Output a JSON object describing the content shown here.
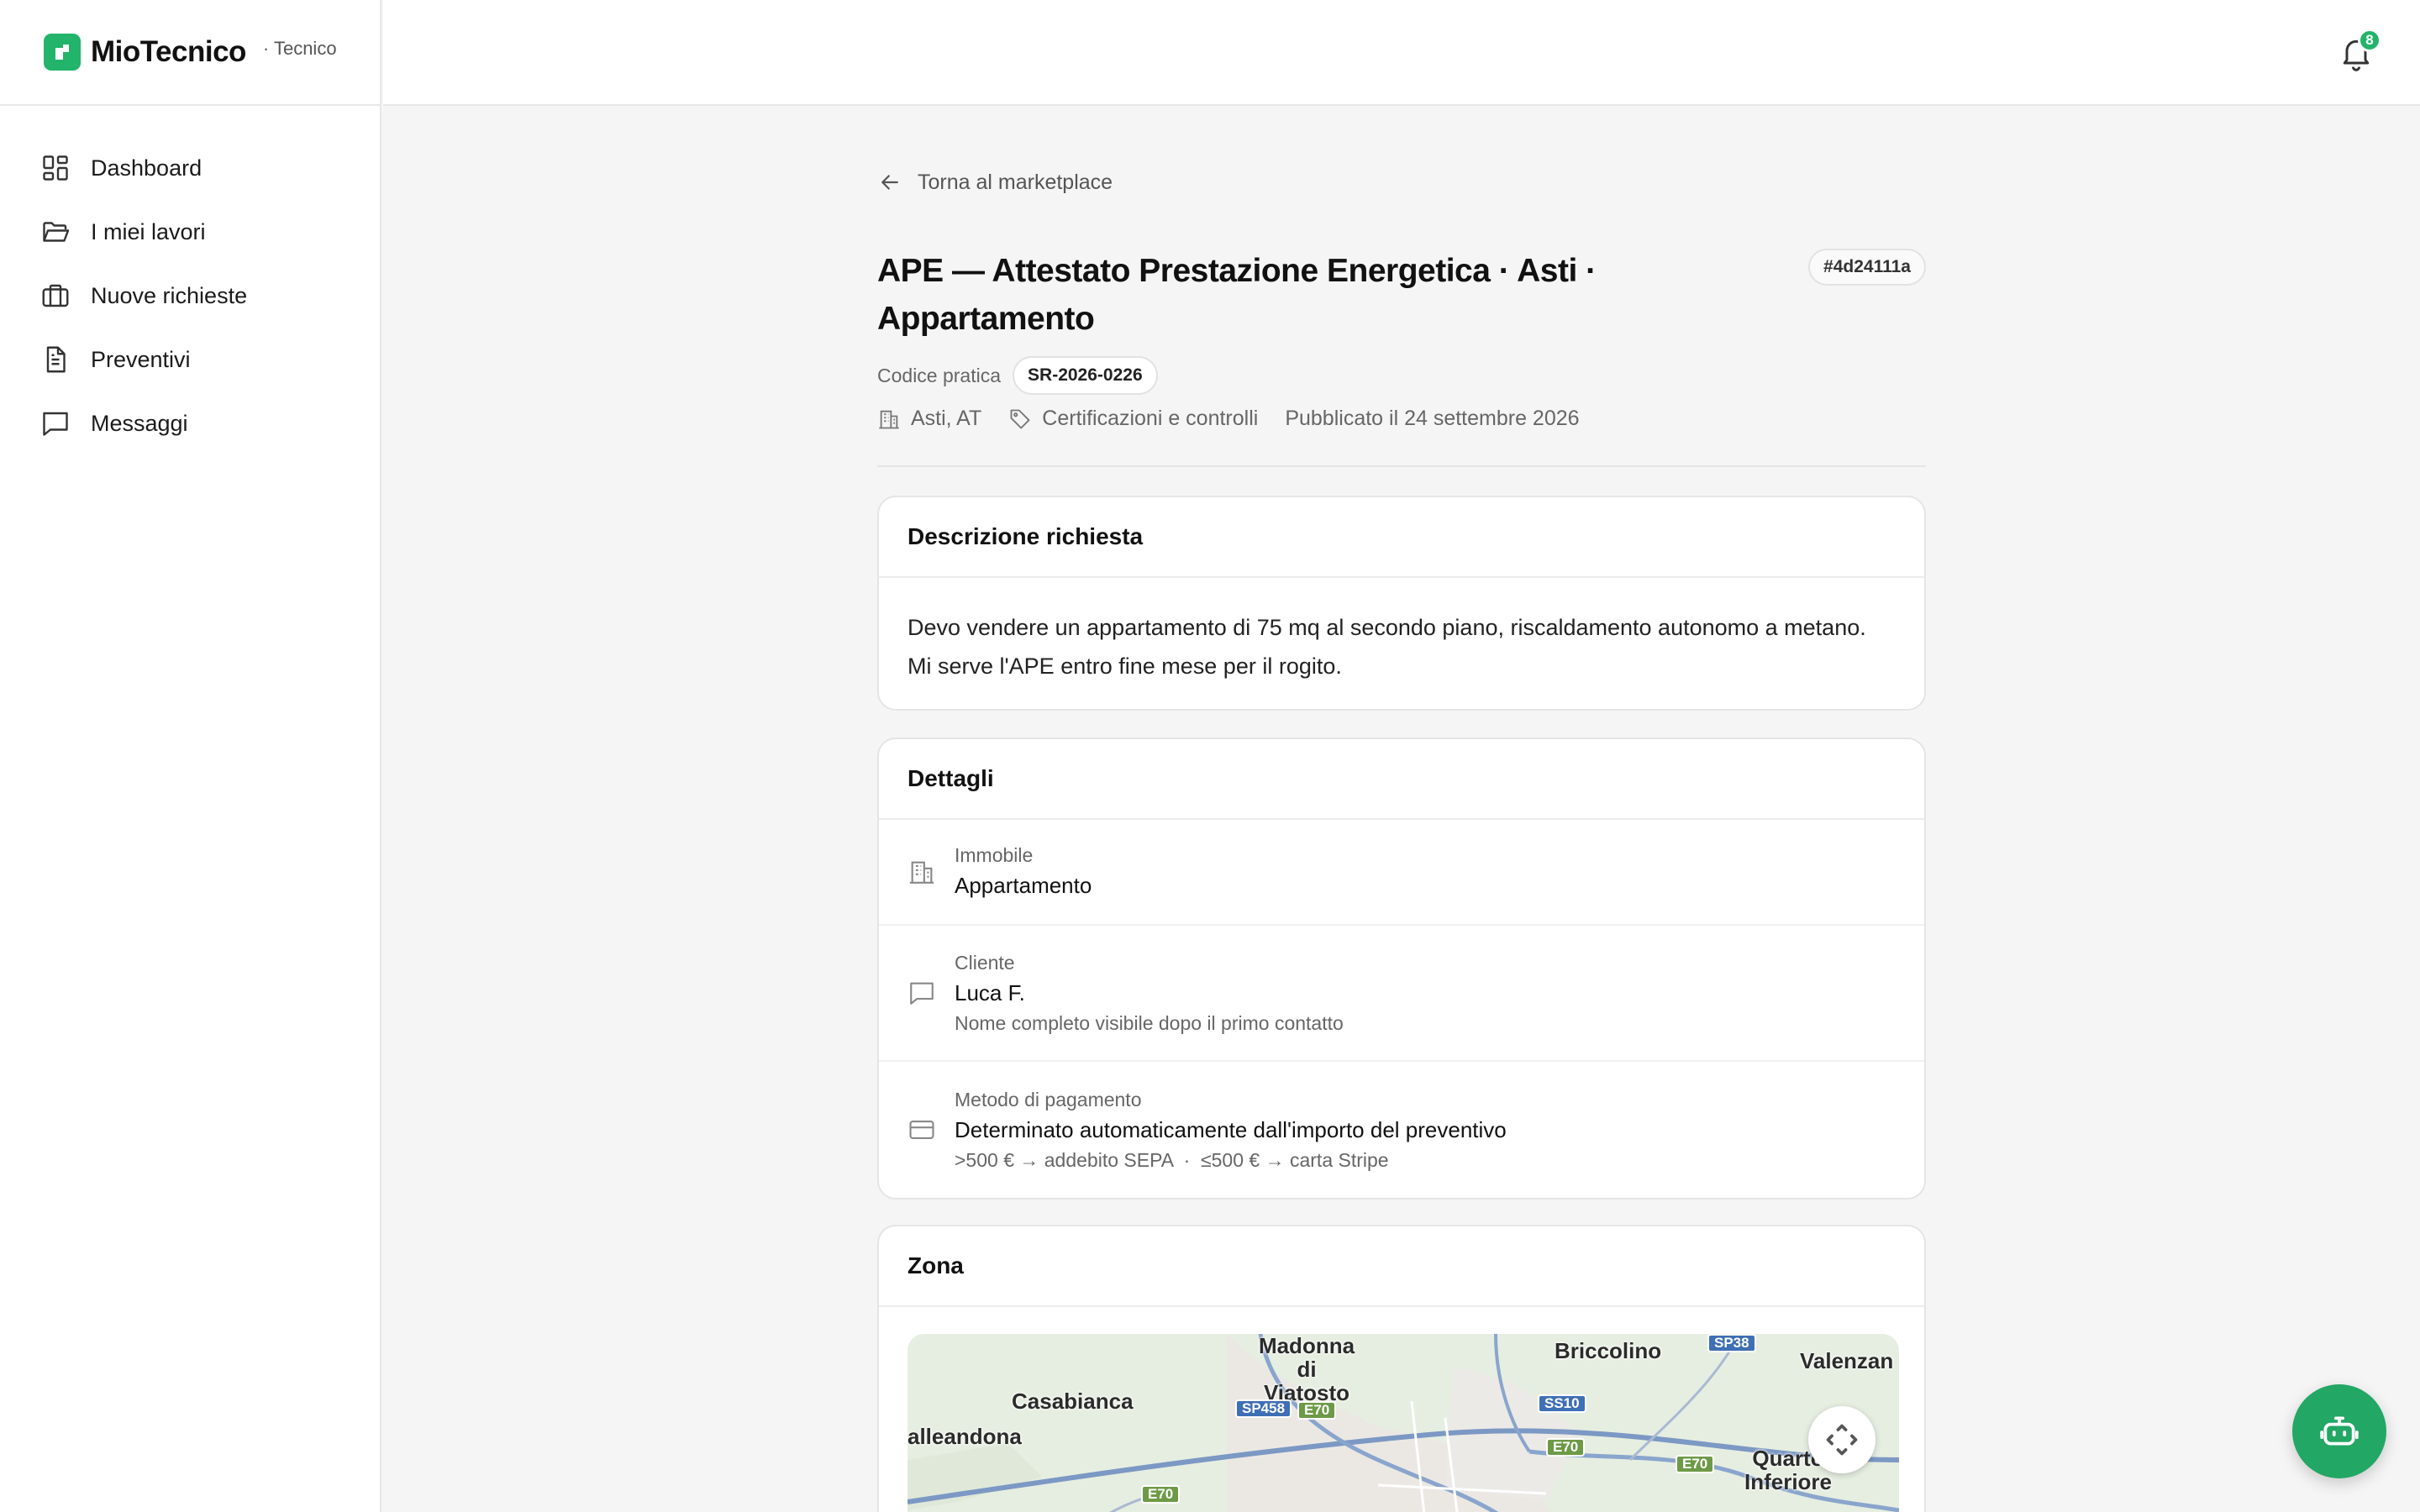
{
  "brand": {
    "name": "MioTecnico",
    "role": "· Tecnico"
  },
  "nav": {
    "items": [
      {
        "label": "Dashboard"
      },
      {
        "label": "I miei lavori"
      },
      {
        "label": "Nuove richieste"
      },
      {
        "label": "Preventivi"
      },
      {
        "label": "Messaggi"
      }
    ]
  },
  "topbar": {
    "notifications_count": "8"
  },
  "page": {
    "back_label": "Torna al marketplace",
    "title": "APE — Attestato Prestazione Energetica · Asti · Appartamento",
    "id_badge": "#4d24111a",
    "code_label": "Codice pratica",
    "code_value": "SR-2026-0226",
    "meta": {
      "location": "Asti, AT",
      "category": "Certificazioni e controlli",
      "published": "Pubblicato il 24 settembre 2026"
    }
  },
  "description_card": {
    "title": "Descrizione richiesta",
    "text": "Devo vendere un appartamento di 75 mq al secondo piano, riscaldamento autonomo a metano. Mi serve l'APE entro fine mese per il rogito."
  },
  "details_card": {
    "title": "Dettagli",
    "property": {
      "label": "Immobile",
      "value": "Appartamento"
    },
    "client": {
      "label": "Cliente",
      "value": "Luca F.",
      "note": "Nome completo visibile dopo il primo contatto"
    },
    "payment": {
      "label": "Metodo di pagamento",
      "value": "Determinato automaticamente dall'importo del preventivo",
      "note": ">500 € → addebito SEPA  ·  ≤500 € → carta Stripe"
    }
  },
  "zone_card": {
    "title": "Zona",
    "map_labels": {
      "madonna": "Madonna di Viatosto",
      "briccolino": "Briccolino",
      "valenzan": "Valenzan",
      "casabianca": "Casabianca",
      "alleandona": "alleandona",
      "quarto": "Quarto Inferiore"
    },
    "road_badges": {
      "sp38": "SP38",
      "sp458": "SP458",
      "e70a": "E70",
      "ss10": "SS10",
      "e70b": "E70",
      "e70c": "E70",
      "e70d": "E70"
    }
  },
  "colors": {
    "accent": "#22b46a",
    "fab": "#22a764"
  }
}
